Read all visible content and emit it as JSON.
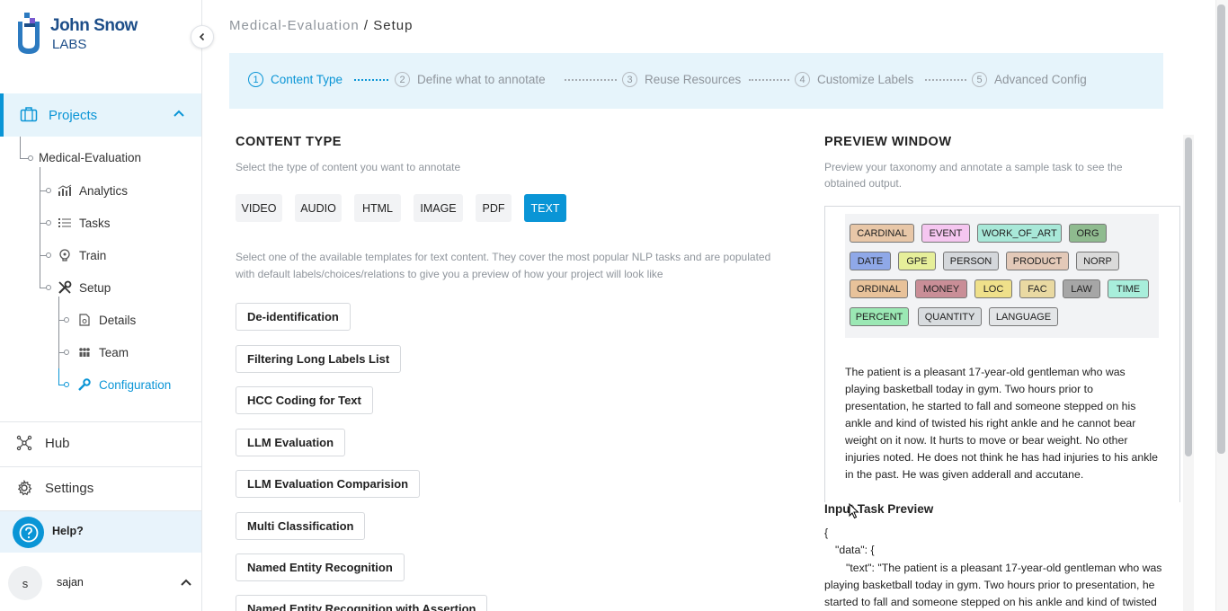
{
  "brand": {
    "line1": "John Snow",
    "line2": "LABS"
  },
  "sidebar": {
    "projects_label": "Projects",
    "tree": {
      "project": "Medical-Evaluation",
      "analytics": "Analytics",
      "tasks": "Tasks",
      "train": "Train",
      "setup": "Setup",
      "details": "Details",
      "team": "Team",
      "configuration": "Configuration"
    },
    "hub": "Hub",
    "settings": "Settings",
    "help": "Help?",
    "user": {
      "initial": "s",
      "name": "sajan"
    }
  },
  "breadcrumb": {
    "project": "Medical-Evaluation",
    "separator": " / ",
    "page": "Setup"
  },
  "steps": [
    {
      "num": "1",
      "label": "Content Type"
    },
    {
      "num": "2",
      "label": "Define what to annotate"
    },
    {
      "num": "3",
      "label": "Reuse Resources"
    },
    {
      "num": "4",
      "label": "Customize Labels"
    },
    {
      "num": "5",
      "label": "Advanced Config"
    }
  ],
  "content_type": {
    "title": "CONTENT TYPE",
    "subtitle": "Select the type of content you want to annotate",
    "types": [
      "VIDEO",
      "AUDIO",
      "HTML",
      "IMAGE",
      "PDF",
      "TEXT"
    ],
    "selected": "TEXT",
    "templates_hint_1": "Select one of the available templates for text content. They cover the most popular NLP tasks and are populated",
    "templates_hint_2": "with default labels/choices/relations to give you a preview of how your project will look like",
    "templates": [
      "De-identification",
      "Filtering Long Labels List",
      "HCC Coding for Text",
      "LLM Evaluation",
      "LLM Evaluation Comparision",
      "Multi Classification",
      "Named Entity Recognition",
      "Named Entity Recognition with Assertion"
    ]
  },
  "preview": {
    "title": "PREVIEW WINDOW",
    "subtitle_1": "Preview your taxonomy and annotate a sample task to see the",
    "subtitle_2": "obtained output.",
    "labels": [
      {
        "name": "CARDINAL",
        "color": "#e8c7a8"
      },
      {
        "name": "EVENT",
        "color": "#f5c6f0"
      },
      {
        "name": "WORK_OF_ART",
        "color": "#a8e8d8"
      },
      {
        "name": "ORG",
        "color": "#8fbb8f"
      },
      {
        "name": "DATE",
        "color": "#8fa8e8"
      },
      {
        "name": "GPE",
        "color": "#e6ef9a"
      },
      {
        "name": "PERSON",
        "color": "#d4d7db"
      },
      {
        "name": "PRODUCT",
        "color": "#e3c9b8"
      },
      {
        "name": "NORP",
        "color": "#dadada"
      },
      {
        "name": "ORDINAL",
        "color": "#e8c29a"
      },
      {
        "name": "MONEY",
        "color": "#c98e97"
      },
      {
        "name": "LOC",
        "color": "#efe08a"
      },
      {
        "name": "FAC",
        "color": "#e9d9a2"
      },
      {
        "name": "LAW",
        "color": "#a6a6a6"
      },
      {
        "name": "TIME",
        "color": "#a8eedb"
      },
      {
        "name": "PERCENT",
        "color": "#9be8b4"
      },
      {
        "name": "QUANTITY",
        "color": "#d8dcdf"
      },
      {
        "name": "LANGUAGE",
        "color": "#e3e5e7"
      }
    ],
    "sample_text": "The patient is a pleasant 17-year-old gentleman who was playing basketball today in gym. Two hours prior to presentation, he started to fall and someone stepped on his ankle and kind of twisted his right ankle and he cannot bear weight on it now. It hurts to move or bear weight. No other injuries noted. He does not think he has had injuries to his ankle in the past. He was given adderall and accutane.",
    "input_task_title": "Input Task Preview",
    "json_lines": [
      "{",
      "\"data\": {",
      "\"text\": \"The patient is a pleasant 17-year-old gentleman who was",
      "playing basketball today in gym. Two hours prior to presentation, he",
      "started to fall and someone stepped on his ankle and kind of twisted"
    ]
  }
}
